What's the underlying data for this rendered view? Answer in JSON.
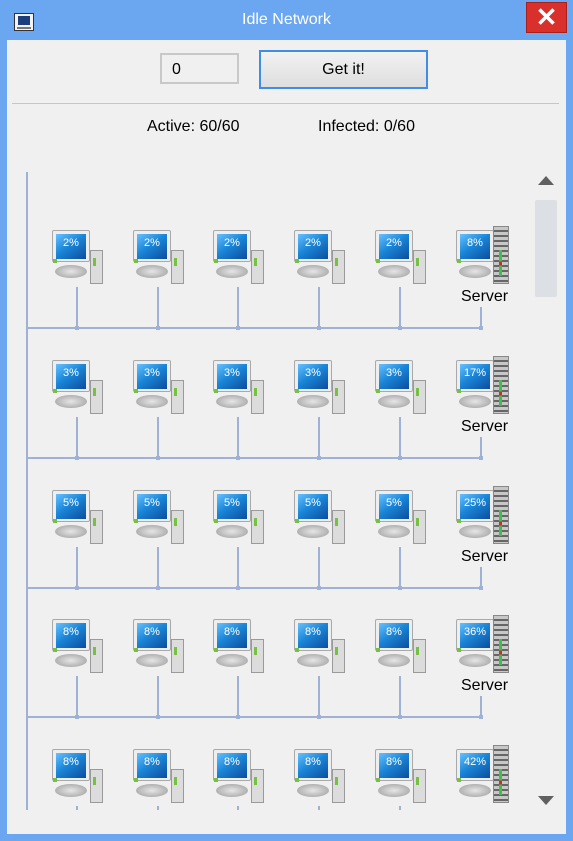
{
  "window": {
    "title": "Idle Network",
    "close_label": "✕"
  },
  "controls": {
    "count_value": "0",
    "get_button_label": "Get it!"
  },
  "status": {
    "active": "Active: 60/60",
    "infected": "Infected: 0/60"
  },
  "network": {
    "server_label": "Server",
    "rows": [
      {
        "pcs": [
          "2%",
          "2%",
          "2%",
          "2%",
          "2%"
        ],
        "server": "8%",
        "show_server_label": true
      },
      {
        "pcs": [
          "3%",
          "3%",
          "3%",
          "3%",
          "3%"
        ],
        "server": "17%",
        "show_server_label": true
      },
      {
        "pcs": [
          "5%",
          "5%",
          "5%",
          "5%",
          "5%"
        ],
        "server": "25%",
        "show_server_label": true
      },
      {
        "pcs": [
          "8%",
          "8%",
          "8%",
          "8%",
          "8%"
        ],
        "server": "36%",
        "show_server_label": true
      },
      {
        "pcs": [
          "8%",
          "8%",
          "8%",
          "8%",
          "8%"
        ],
        "server": "42%",
        "show_server_label": false
      }
    ]
  },
  "colors": {
    "titlebar": "#6aa7f0",
    "close": "#d9302c",
    "accent": "#3f8ee6"
  }
}
